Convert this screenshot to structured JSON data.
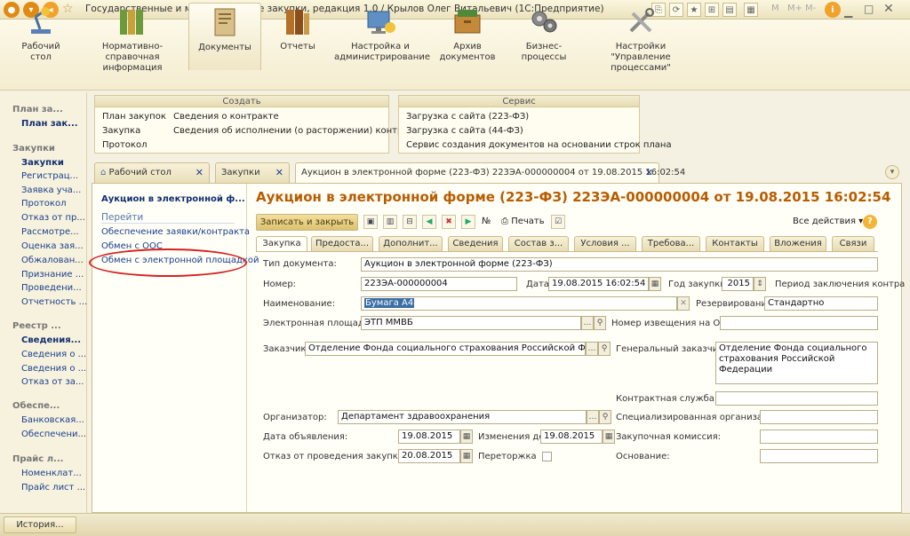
{
  "window": {
    "title": "Государственные и муниципальные закупки, редакция 1.0 / Крылов Олег Витальевич  (1С:Предприятие)",
    "controls": [
      "M",
      "M+",
      "M-"
    ]
  },
  "sections": [
    {
      "label": "Рабочий стол",
      "icon": "desk-lamp-icon"
    },
    {
      "label": "Нормативно-справочная информация",
      "icon": "binders-icon"
    },
    {
      "label": "Документы",
      "icon": "documents-icon"
    },
    {
      "label": "Отчеты",
      "icon": "reports-icon"
    },
    {
      "label": "Настройка и администрирование",
      "icon": "admin-settings-icon"
    },
    {
      "label": "Архив документов",
      "icon": "archive-icon"
    },
    {
      "label": "Бизнес-процессы",
      "icon": "business-process-icon"
    },
    {
      "label": "Настройки \"Управление процессами\"",
      "icon": "tools-icon"
    }
  ],
  "leftnav": {
    "groups": [
      {
        "header": "План за...",
        "items": [
          "План зак..."
        ]
      },
      {
        "header": "Закупки",
        "items": [
          "Закупки",
          "Регистрац...",
          "Заявка уча...",
          "Протокол",
          "Отказ от пр...",
          "Рассмотре...",
          "Оценка зая...",
          "Обжалован...",
          "Признание ...",
          "Проведени...",
          "Отчетность ..."
        ]
      },
      {
        "header": "Реестр ...",
        "items": [
          "Сведения...",
          "Сведения о ...",
          "Сведения о ...",
          "Отказ от за..."
        ]
      },
      {
        "header": "Обеспе...",
        "items": [
          "Банковская...",
          "Обеспечени..."
        ]
      },
      {
        "header": "Прайс л...",
        "items": [
          "Номенклат...",
          "Прайс лист ..."
        ]
      }
    ]
  },
  "command_panel": {
    "create": {
      "header": "Создать",
      "col1": [
        "План закупок",
        "Закупка",
        "Протокол"
      ],
      "col2": [
        "Сведения о контракте",
        "Сведения об исполнении (о расторжении) контракта"
      ]
    },
    "service": {
      "header": "Сервис",
      "items": [
        "Загрузка с сайта (223-ФЗ)",
        "Загрузка с сайта (44-ФЗ)",
        "Сервис создания документов на основании строк плана"
      ]
    }
  },
  "open_tabs": [
    {
      "label": "Рабочий стол"
    },
    {
      "label": "Закупки"
    },
    {
      "label": "Аукцион в электронной форме (223-ФЗ) 223ЭА-000000004 от 19.08.2015 16:02:54"
    }
  ],
  "doc_nav": {
    "current": "Аукцион в электронной ф...",
    "goto_header": "Перейти",
    "links": [
      "Обеспечение заявки/контракта",
      "Обмен с ООС",
      "Обмен с электронной площадкой"
    ]
  },
  "document": {
    "title": "Аукцион в электронной форме (223-ФЗ) 223ЭА-000000004 от 19.08.2015 16:02:54",
    "save_close": "Записать и закрыть",
    "print": "Печать",
    "all_actions": "Все действия",
    "number_sign": "№",
    "tabs": [
      "Закупка",
      "Предоста...",
      "Дополнит...",
      "Сведения",
      "Состав з...",
      "Условия ...",
      "Требова...",
      "Контакты",
      "Вложения",
      "Связи"
    ],
    "fields": {
      "doc_type_label": "Тип документа:",
      "doc_type": "Аукцион в электронной форме (223-ФЗ)",
      "number_label": "Номер:",
      "number": "223ЭА-000000004",
      "date_label": "Дата:",
      "date": "19.08.2015 16:02:54",
      "year_label": "Год закупки:",
      "year": "2015",
      "period_label": "Период заключения контра",
      "name_label": "Наименование:",
      "name": "Бумага А4",
      "reservation_label": "Резервирование:",
      "reservation": "Стандартно",
      "platform_label": "Электронная площадка:",
      "platform": "ЭТП ММВБ",
      "notice_label": "Номер извещения на ООС:",
      "customer_label": "Заказчик:",
      "customer": "Отделение Фонда социального страхования Российской Федерации",
      "general_customer_label": "Генеральный заказчик:",
      "general_customer": "Отделение Фонда социального страхования Российской Федерации",
      "contract_service_label": "Контрактная служба:",
      "organizer_label": "Организатор:",
      "organizer": "Департамент здравоохранения",
      "special_org_label": "Специализированная организация:",
      "announce_date_label": "Дата объявления:",
      "announce_date": "19.08.2015",
      "changes_to_label": "Изменения до :",
      "changes_to": "19.08.2015",
      "commission_label": "Закупочная комиссия:",
      "refusal_label": "Отказ от проведения закупки до:",
      "refusal_date": "20.08.2015",
      "rebid_label": "Переторжка",
      "basis_label": "Основание:"
    }
  },
  "status_bar": {
    "history": "История..."
  }
}
